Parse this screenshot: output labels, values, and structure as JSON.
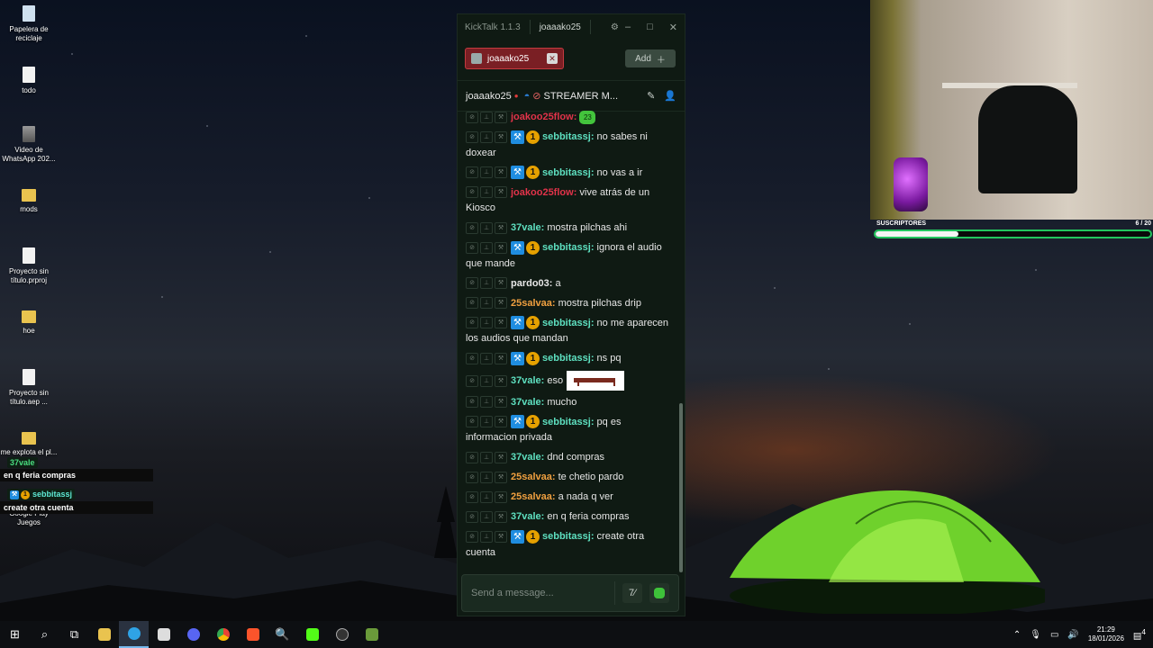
{
  "desktop": {
    "icons": [
      {
        "label": "Papelera de reciclaje"
      },
      {
        "label": "todo"
      },
      {
        "label": "Video de WhatsApp 202..."
      },
      {
        "label": "mods"
      },
      {
        "label": "Proyecto sin título.prproj"
      },
      {
        "label": "hoe"
      },
      {
        "label": "Proyecto sin título.aep ..."
      },
      {
        "label": "me explota el pl... ...al..."
      },
      {
        "label": "Google Play Juegos"
      }
    ]
  },
  "overlay_chat": [
    {
      "user": "37vale",
      "user_color": "#4ade80",
      "message": "en q feria compras"
    },
    {
      "user": "sebbitassj",
      "user_color": "#5eead4",
      "message": "create otra cuenta"
    }
  ],
  "kicktalk": {
    "title": "KickTalk 1.1.3",
    "account": "joaaako25",
    "tab_label": "joaaako25",
    "add_label": "Add",
    "channel_name": "joaaako25",
    "mode_label": "STREAMER M...",
    "input_placeholder": "Send a message...",
    "messages": [
      {
        "user": "joakoo25flow",
        "color": "#e2334a",
        "text": "",
        "badges": false,
        "emote": "green"
      },
      {
        "user": "sebbitassj",
        "color": "#5ee0c0",
        "text": "no sabes ni doxear",
        "badges": true
      },
      {
        "user": "sebbitassj",
        "color": "#5ee0c0",
        "text": "no vas a ir",
        "badges": true
      },
      {
        "user": "joakoo25flow",
        "color": "#e2334a",
        "text": "vive atrás de un Kiosco",
        "badges": false
      },
      {
        "user": "37vale",
        "color": "#5ee0c0",
        "text": "mostra pilchas ahi",
        "badges": false
      },
      {
        "user": "sebbitassj",
        "color": "#5ee0c0",
        "text": "ignora el audio que mande",
        "badges": true
      },
      {
        "user": "pardo03",
        "color": "#e8e8e8",
        "text": "a",
        "badges": false
      },
      {
        "user": "25salvaa",
        "color": "#f0a040",
        "text": "mostra pilchas drip",
        "badges": false
      },
      {
        "user": "sebbitassj",
        "color": "#5ee0c0",
        "text": "no me aparecen los audios que mandan",
        "badges": true
      },
      {
        "user": "sebbitassj",
        "color": "#5ee0c0",
        "text": "ns pq",
        "badges": true
      },
      {
        "user": "37vale",
        "color": "#5ee0c0",
        "text": "eso",
        "badges": false,
        "emote": "bench"
      },
      {
        "user": "37vale",
        "color": "#5ee0c0",
        "text": "mucho",
        "badges": false
      },
      {
        "user": "sebbitassj",
        "color": "#5ee0c0",
        "text": "pq es informacion privada",
        "badges": true
      },
      {
        "user": "37vale",
        "color": "#5ee0c0",
        "text": "dnd compras",
        "badges": false
      },
      {
        "user": "25salvaa",
        "color": "#f0a040",
        "text": "te chetio pardo",
        "badges": false
      },
      {
        "user": "25salvaa",
        "color": "#f0a040",
        "text": "a nada q ver",
        "badges": false
      },
      {
        "user": "37vale",
        "color": "#5ee0c0",
        "text": "en q feria compras",
        "badges": false
      },
      {
        "user": "sebbitassj",
        "color": "#5ee0c0",
        "text": "create otra cuenta",
        "badges": true
      }
    ]
  },
  "subs_widget": {
    "label": "SUSCRIPTORES",
    "count": "6 / 20",
    "progress": 0.3
  },
  "taskbar": {
    "time": "21:29",
    "date": "18/01/2026",
    "notifications": "4"
  }
}
